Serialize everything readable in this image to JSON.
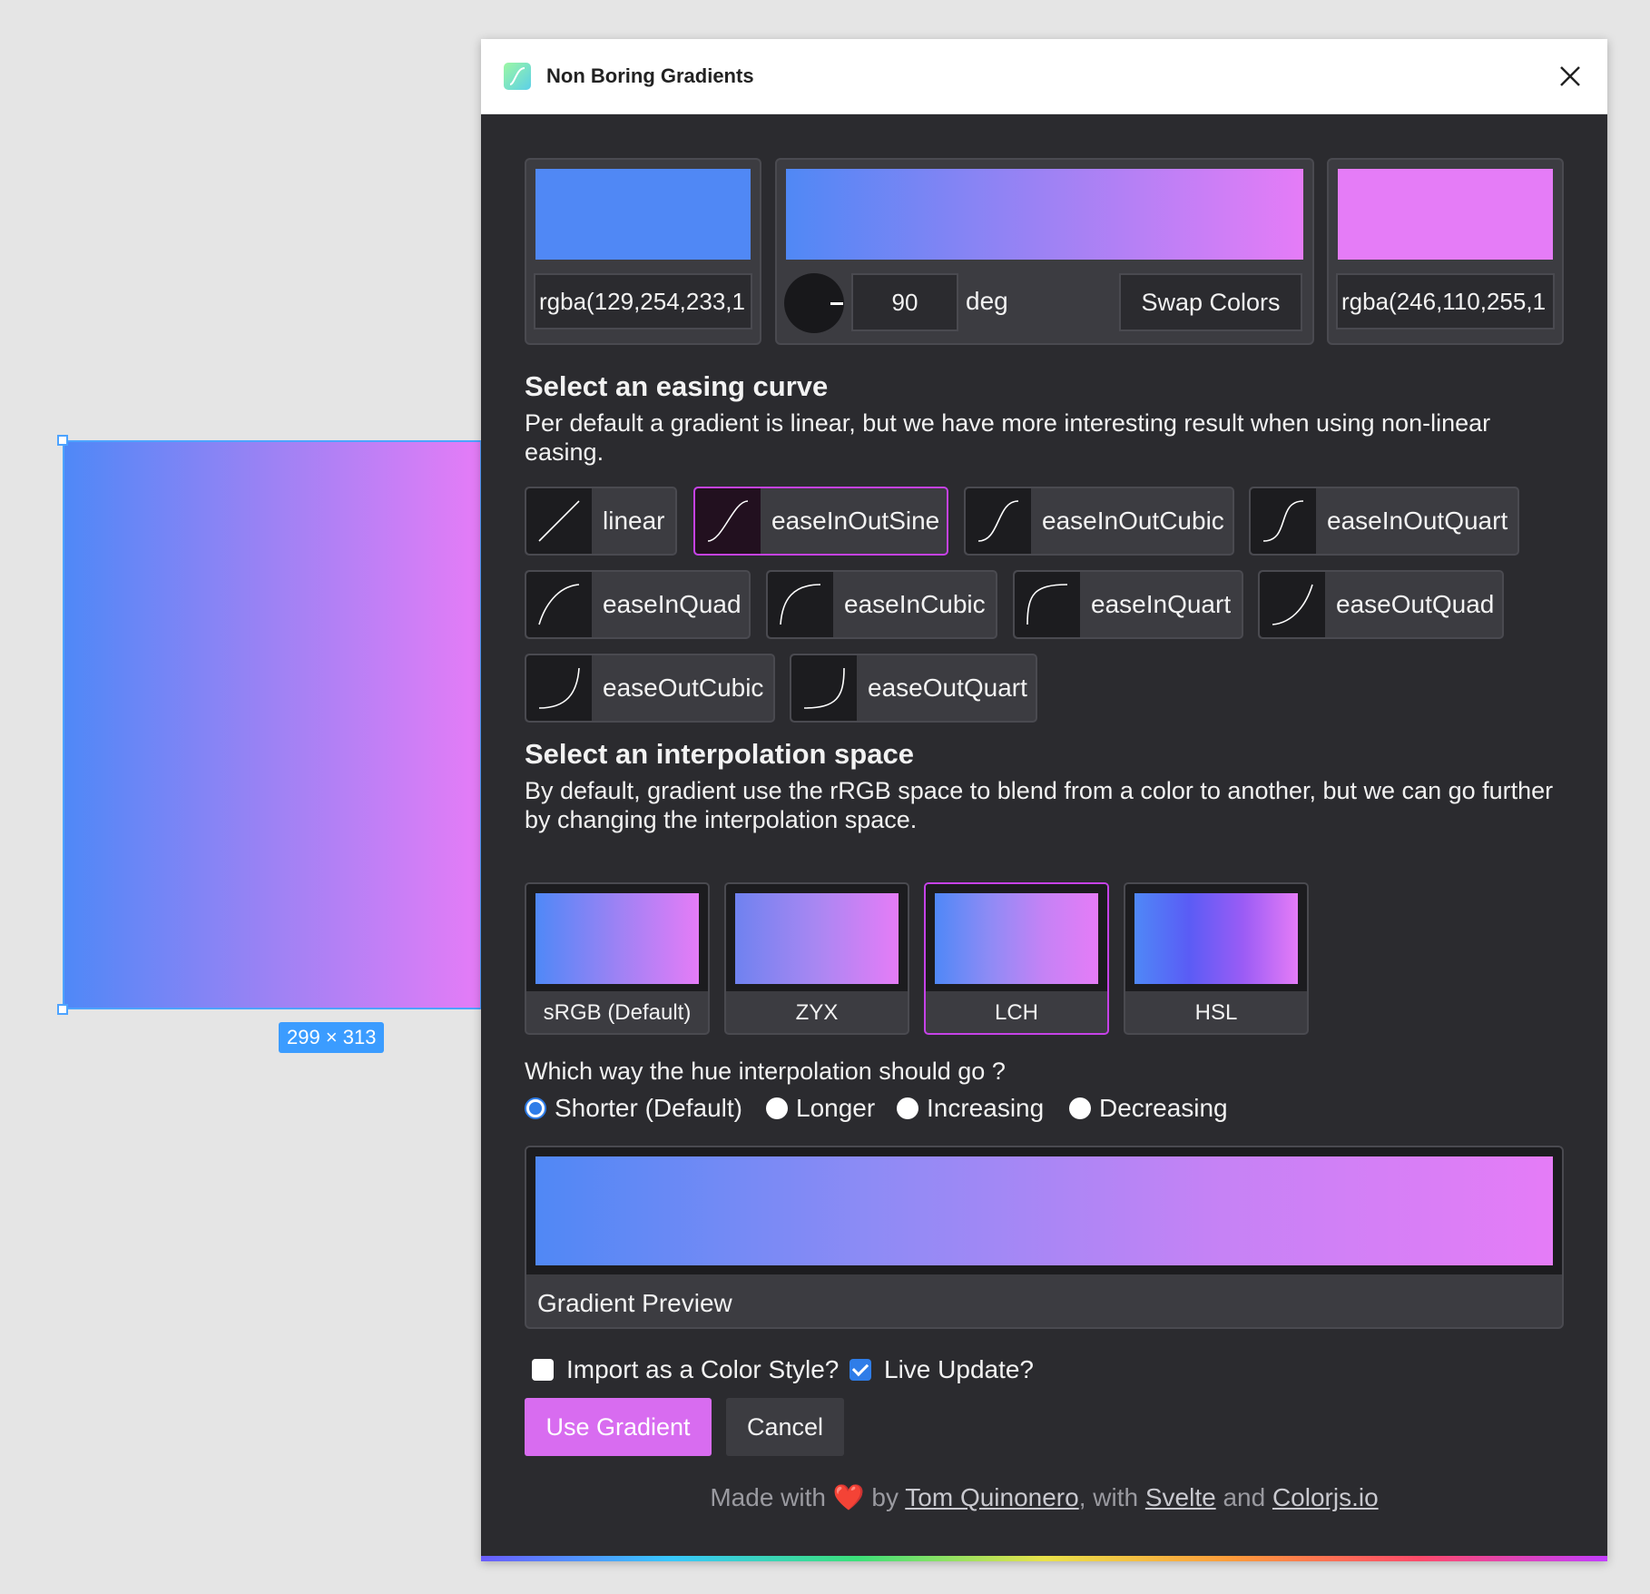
{
  "canvas": {
    "size_badge": "299 × 313",
    "fill_from": "#4f88f7",
    "fill_to": "#e57cf7"
  },
  "window": {
    "title": "Non Boring Gradients"
  },
  "colors": {
    "start_value": "rgba(129,254,233,1",
    "end_value": "rgba(246,110,255,1",
    "start_swatch": "#5088f5",
    "end_swatch": "#e57cf7",
    "accent": "#d86cf0",
    "selection_border": "#c642e8"
  },
  "angle": {
    "value": "90",
    "unit": "deg"
  },
  "swap_label": "Swap Colors",
  "easing": {
    "heading": "Select an easing curve",
    "description": "Per default a gradient is linear, but we have more interesting result when using non-linear easing.",
    "options": [
      {
        "label": "linear",
        "selected": false
      },
      {
        "label": "easeInOutSine",
        "selected": true
      },
      {
        "label": "easeInOutCubic",
        "selected": false
      },
      {
        "label": "easeInOutQuart",
        "selected": false
      },
      {
        "label": "easeInQuad",
        "selected": false
      },
      {
        "label": "easeInCubic",
        "selected": false
      },
      {
        "label": "easeInQuart",
        "selected": false
      },
      {
        "label": "easeOutQuad",
        "selected": false
      },
      {
        "label": "easeOutCubic",
        "selected": false
      },
      {
        "label": "easeOutQuart",
        "selected": false
      }
    ]
  },
  "interpolation": {
    "heading": "Select an interpolation space",
    "description": "By default, gradient use the rRGB space to blend from a color to another, but we can go further by changing the interpolation space.",
    "spaces": [
      {
        "label": "sRGB (Default)",
        "selected": false
      },
      {
        "label": "ZYX",
        "selected": false
      },
      {
        "label": "LCH",
        "selected": true
      },
      {
        "label": "HSL",
        "selected": false
      }
    ]
  },
  "hue": {
    "question": "Which way the hue interpolation should go ?",
    "options": [
      {
        "label": "Shorter (Default)",
        "checked": true
      },
      {
        "label": "Longer",
        "checked": false
      },
      {
        "label": "Increasing",
        "checked": false
      },
      {
        "label": "Decreasing",
        "checked": false
      }
    ]
  },
  "preview": {
    "label": "Gradient Preview"
  },
  "options": {
    "import_style": {
      "label": "Import as a Color Style?",
      "checked": false
    },
    "live_update": {
      "label": "Live Update?",
      "checked": true
    }
  },
  "buttons": {
    "use": "Use Gradient",
    "cancel": "Cancel"
  },
  "footer": {
    "made_with": "Made with",
    "heart": "❤️",
    "by": "by",
    "author": "Tom Quinonero",
    "with": ", with",
    "svelte": "Svelte",
    "and": "and",
    "colorjs": "Colorjs.io"
  }
}
